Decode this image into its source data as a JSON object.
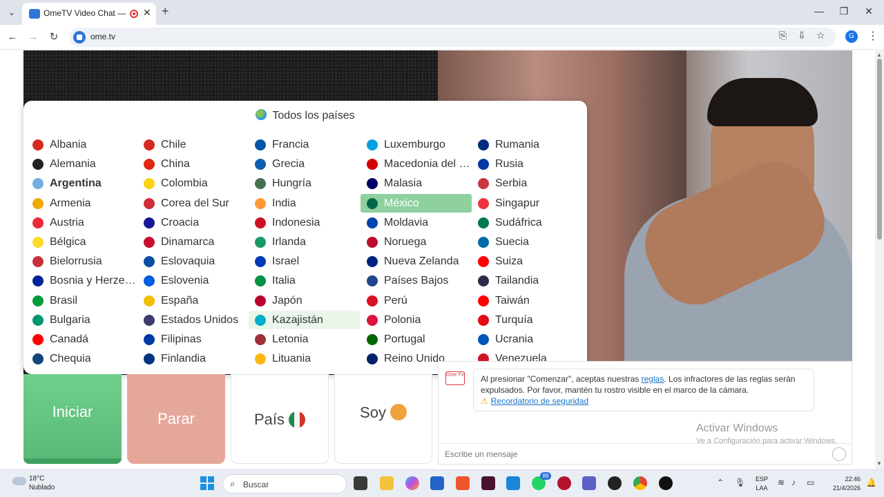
{
  "browser": {
    "tab_title": "OmeTV Video Chat — Ome",
    "tab_close": "✕",
    "new_tab": "+",
    "url": "ome.tv",
    "profile_initial": "G",
    "icons": [
      "translate-icon",
      "install-icon",
      "bookmark-star-icon",
      "more-menu-icon"
    ]
  },
  "panel": {
    "header": "Todos los países",
    "columns": [
      [
        {
          "name": "Albania",
          "flag": "#d52b1e"
        },
        {
          "name": "Alemania",
          "flag": "#222222"
        },
        {
          "name": "Argentina",
          "flag": "#74acdf",
          "bold": true
        },
        {
          "name": "Armenia",
          "flag": "#f2a800"
        },
        {
          "name": "Austria",
          "flag": "#ed2939"
        },
        {
          "name": "Bélgica",
          "flag": "#fdda24"
        },
        {
          "name": "Bielorrusia",
          "flag": "#c8313e"
        },
        {
          "name": "Bosnia y Herzegovina",
          "flag": "#002395"
        },
        {
          "name": "Brasil",
          "flag": "#009c3b"
        },
        {
          "name": "Bulgaria",
          "flag": "#00966e"
        },
        {
          "name": "Canadá",
          "flag": "#ff0000"
        },
        {
          "name": "Chequia",
          "flag": "#11457e"
        }
      ],
      [
        {
          "name": "Chile",
          "flag": "#d52b1e"
        },
        {
          "name": "China",
          "flag": "#de2910"
        },
        {
          "name": "Colombia",
          "flag": "#fcd116"
        },
        {
          "name": "Corea del Sur",
          "flag": "#cd2e3a"
        },
        {
          "name": "Croacia",
          "flag": "#171796"
        },
        {
          "name": "Dinamarca",
          "flag": "#c8102e"
        },
        {
          "name": "Eslovaquia",
          "flag": "#0b4ea2"
        },
        {
          "name": "Eslovenia",
          "flag": "#005ce5"
        },
        {
          "name": "España",
          "flag": "#f1bf00"
        },
        {
          "name": "Estados Unidos",
          "flag": "#3c3b6e"
        },
        {
          "name": "Filipinas",
          "flag": "#0038a8"
        },
        {
          "name": "Finlandia",
          "flag": "#003580"
        }
      ],
      [
        {
          "name": "Francia",
          "flag": "#0055a4"
        },
        {
          "name": "Grecia",
          "flag": "#0d5eaf"
        },
        {
          "name": "Hungría",
          "flag": "#477050"
        },
        {
          "name": "India",
          "flag": "#ff9933"
        },
        {
          "name": "Indonesia",
          "flag": "#ce1126"
        },
        {
          "name": "Irlanda",
          "flag": "#169b62"
        },
        {
          "name": "Israel",
          "flag": "#0038b8"
        },
        {
          "name": "Italia",
          "flag": "#009246"
        },
        {
          "name": "Japón",
          "flag": "#bc002d"
        },
        {
          "name": "Kazajistán",
          "flag": "#00afca",
          "hover": true
        },
        {
          "name": "Letonia",
          "flag": "#9e3039"
        },
        {
          "name": "Lituania",
          "flag": "#fdb913"
        }
      ],
      [
        {
          "name": "Luxemburgo",
          "flag": "#00a1de"
        },
        {
          "name": "Macedonia del Norte",
          "flag": "#d20000"
        },
        {
          "name": "Malasia",
          "flag": "#010066"
        },
        {
          "name": "México",
          "flag": "#006847",
          "selected": true
        },
        {
          "name": "Moldavia",
          "flag": "#0046ae"
        },
        {
          "name": "Noruega",
          "flag": "#ba0c2f"
        },
        {
          "name": "Nueva Zelanda",
          "flag": "#00247d"
        },
        {
          "name": "Países Bajos",
          "flag": "#21468b"
        },
        {
          "name": "Perú",
          "flag": "#d91023"
        },
        {
          "name": "Polonia",
          "flag": "#dc143c"
        },
        {
          "name": "Portugal",
          "flag": "#006600"
        },
        {
          "name": "Reino Unido",
          "flag": "#012169"
        }
      ],
      [
        {
          "name": "Rumania",
          "flag": "#002b7f"
        },
        {
          "name": "Rusia",
          "flag": "#0039a6"
        },
        {
          "name": "Serbia",
          "flag": "#c6363c"
        },
        {
          "name": "Singapur",
          "flag": "#ef3340"
        },
        {
          "name": "Sudáfrica",
          "flag": "#007a4d"
        },
        {
          "name": "Suecia",
          "flag": "#006aa7"
        },
        {
          "name": "Suiza",
          "flag": "#ff0000"
        },
        {
          "name": "Tailandia",
          "flag": "#2d2a4a"
        },
        {
          "name": "Taiwán",
          "flag": "#fe0000"
        },
        {
          "name": "Turquía",
          "flag": "#e30a17"
        },
        {
          "name": "Ucrania",
          "flag": "#0057b7"
        },
        {
          "name": "Venezuela",
          "flag": "#cf142b"
        }
      ]
    ]
  },
  "controls": {
    "start": "Iniciar",
    "stop": "Parar",
    "country": "País",
    "soy": "Soy"
  },
  "chat": {
    "logo": "Ome TV",
    "notice_before_link": "Al presionar \"Comenzar\", aceptas nuestras ",
    "notice_link": "reglas",
    "notice_after_link": ". Los infractores de las reglas serán expulsados. Por favor, mantén tu rostro visible en el marco de la cámara.",
    "safety_link": "Recordatorio de seguridad",
    "input_placeholder": "Escribe un mensaje"
  },
  "watermark": {
    "title": "Activar Windows",
    "subtitle": "Ve a Configuración para activar Windows."
  },
  "taskbar": {
    "temperature": "18°C",
    "weather": "Nublado",
    "search": "Buscar",
    "whatsapp_badge": "89",
    "lang_top": "ESP",
    "lang_bottom": "LAA",
    "time": "22:46",
    "date": "21/4/2026"
  },
  "colors": {
    "start_green": "#58b877",
    "stop_salmon": "#e6a79b",
    "selected_green": "#8fd19e",
    "link_blue": "#1a73c8"
  }
}
